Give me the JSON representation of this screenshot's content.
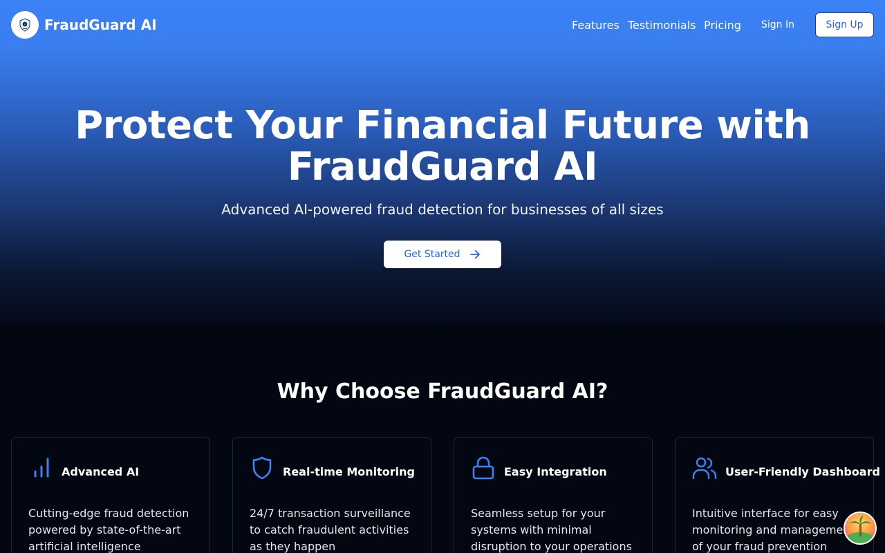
{
  "nav": {
    "brand": "FraudGuard AI",
    "links": [
      "Features",
      "Testimonials",
      "Pricing"
    ],
    "sign_in": "Sign In",
    "sign_up": "Sign Up"
  },
  "hero": {
    "title_line1": "Protect Your Financial Future with",
    "title_line2": "FraudGuard AI",
    "subtitle": "Advanced AI-powered fraud detection for businesses of all sizes",
    "cta_label": "Get Started"
  },
  "features": {
    "title": "Why Choose FraudGuard AI?",
    "items": [
      {
        "icon": "bar-chart-icon",
        "title": "Advanced AI",
        "description": "Cutting-edge fraud detection powered by state-of-the-art artificial intelligence"
      },
      {
        "icon": "shield-icon",
        "title": "Real-time Monitoring",
        "description": "24/7 transaction surveillance to catch fraudulent activities as they happen"
      },
      {
        "icon": "lock-icon",
        "title": "Easy Integration",
        "description": "Seamless setup for your systems with minimal disruption to your operations"
      },
      {
        "icon": "users-icon",
        "title": "User-Friendly Dashboard",
        "description": "Intuitive interface for easy monitoring and management of your fraud prevention"
      }
    ]
  },
  "colors": {
    "accent": "#3b82f6",
    "button_text": "#2563eb",
    "background": "#030712",
    "card_border": "#1f2937"
  }
}
